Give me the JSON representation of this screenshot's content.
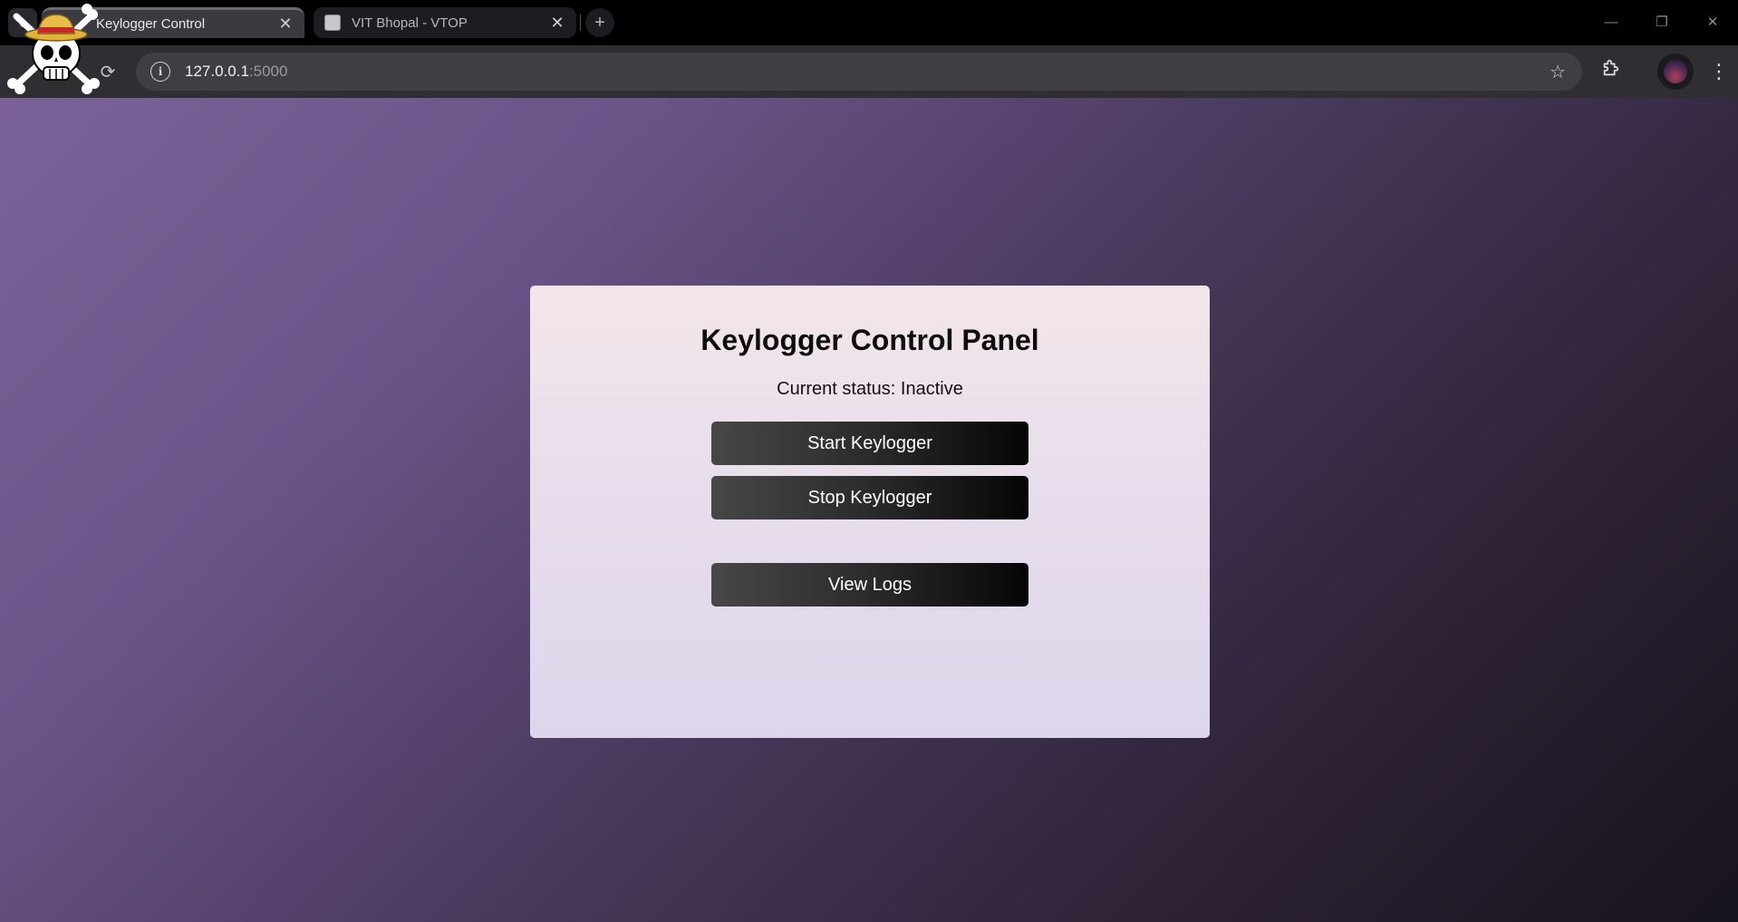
{
  "browser": {
    "tabs": [
      {
        "title": "Keylogger Control",
        "active": true
      },
      {
        "title": "VIT Bhopal - VTOP",
        "active": false
      }
    ],
    "new_tab_symbol": "+",
    "close_symbol": "✕",
    "address_host": "127.0.0.1",
    "address_port": ":5000",
    "icons": {
      "tab_search": "chevron-down-icon",
      "reload": "reload-icon",
      "site_info": "info-icon",
      "bookmark": "star-icon",
      "extensions": "puzzle-icon",
      "menu": "three-dot-menu-icon",
      "profile": "profile-avatar",
      "overlay": "jolly-roger-skull-icon"
    },
    "window_controls": {
      "minimize": "—",
      "restore": "❐",
      "close": "✕"
    }
  },
  "page": {
    "title": "Keylogger Control Panel",
    "status": "Current status: Inactive",
    "buttons": {
      "start": "Start Keylogger",
      "stop": "Stop Keylogger",
      "logs": "View Logs"
    },
    "colors": {
      "background_start": "#7a6197",
      "background_end": "#17131b",
      "panel": "#ebe0ec",
      "button": "#000000",
      "button_text": "#ffffff"
    }
  }
}
